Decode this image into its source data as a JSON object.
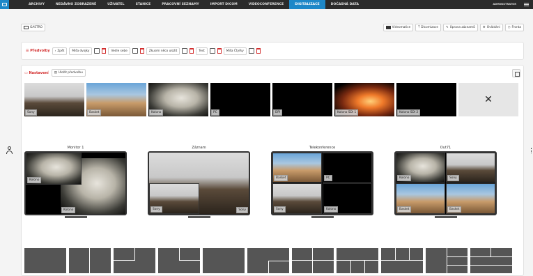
{
  "topbar": {
    "nav": [
      "ARCHIVY",
      "NEDÁVNO ZOBRAZENÉ",
      "UŽIVATEL",
      "STANICE",
      "PRACOVNÍ SEZNAMY",
      "IMPORT DICOM",
      "VIDEOCONFERENCE",
      "DIGITALIZACE",
      "DOČASNÁ DATA"
    ],
    "active_index": 7,
    "user": "ADMINISTRATOR"
  },
  "toolbar": {
    "gastro": "GASTRO",
    "videomatice": "Videomatice",
    "dicomizace": "Dicomizace",
    "uprava": "Úprava záznamů",
    "ovladani": "Ovládání",
    "fronta": "Fronta"
  },
  "presets": {
    "title": "Předvolby",
    "back": "Zpět",
    "items": [
      "Miša dvojky",
      "Vedle sebe",
      "Zkusmi něco uložit",
      "Test",
      "Miša Čtyřky"
    ]
  },
  "settings": {
    "title": "Nastavení",
    "save": "Uložit předvolbu"
  },
  "sources": [
    {
      "label": "Sony",
      "img": "crowd"
    },
    {
      "label": "Basket",
      "img": "city"
    },
    {
      "label": "Kolono",
      "img": "endo"
    },
    {
      "label": "PC",
      "img": "black"
    },
    {
      "label": "DPI",
      "img": "black"
    },
    {
      "label": "Kolono SDI 1",
      "img": "fire"
    },
    {
      "label": "Kolono SDI 2",
      "img": "black"
    }
  ],
  "close_symbol": "✕",
  "monitors": [
    {
      "title": "Monitor 1"
    },
    {
      "title": "Záznam"
    },
    {
      "title": "Telekonference"
    },
    {
      "title": "Out71"
    }
  ],
  "monitor_labels": {
    "m1_a": "Kolono",
    "m1_b": "Kolono",
    "m2_a": "Sony",
    "m2_b": "Sony",
    "m3_a": "Basket",
    "m3_b": "PC",
    "m3_c": "Sony",
    "m3_d": "Kolono",
    "m4_a": "Kolono",
    "m4_b": "Sony",
    "m4_c": "Basket",
    "m4_d": "Basket"
  },
  "colors": {
    "accent": "#1e88c8",
    "danger": "#d32f2f",
    "topbar": "#2b2b2b"
  }
}
